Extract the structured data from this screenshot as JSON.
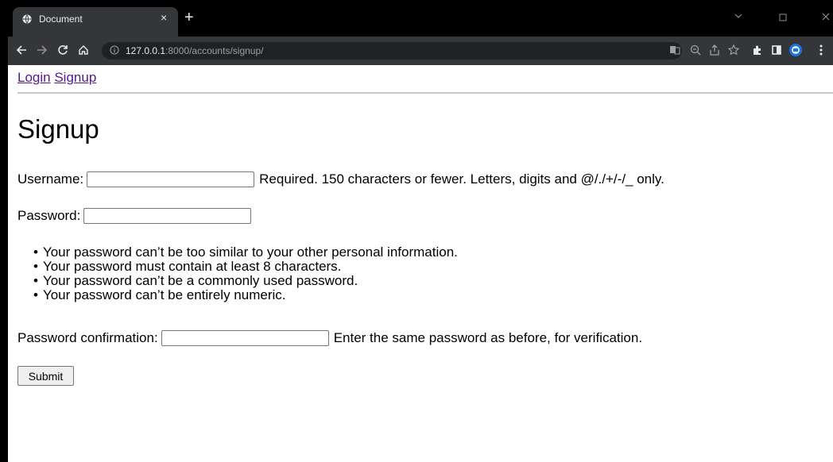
{
  "browser": {
    "tab_title": "Document",
    "tab_close": "×",
    "new_tab": "+",
    "url_scheme_host": "127.0.0.1",
    "url_rest": ":8000/accounts/signup/"
  },
  "nav": {
    "login": "Login",
    "signup": "Signup"
  },
  "form": {
    "heading": "Signup",
    "username_label": "Username:",
    "username_value": "",
    "username_help": "Required. 150 characters or fewer. Letters, digits and @/./+/-/_ only.",
    "password_label": "Password:",
    "password_value": "",
    "password_hints": [
      "Your password can’t be too similar to your other personal information.",
      "Your password must contain at least 8 characters.",
      "Your password can’t be a commonly used password.",
      "Your password can’t be entirely numeric."
    ],
    "confirm_label": "Password confirmation:",
    "confirm_value": "",
    "confirm_help": "Enter the same password as before, for verification.",
    "submit_label": "Submit"
  },
  "colors": {
    "link_visited": "#551a8b",
    "toolbar": "#35363a",
    "tabstrip": "#000000"
  }
}
